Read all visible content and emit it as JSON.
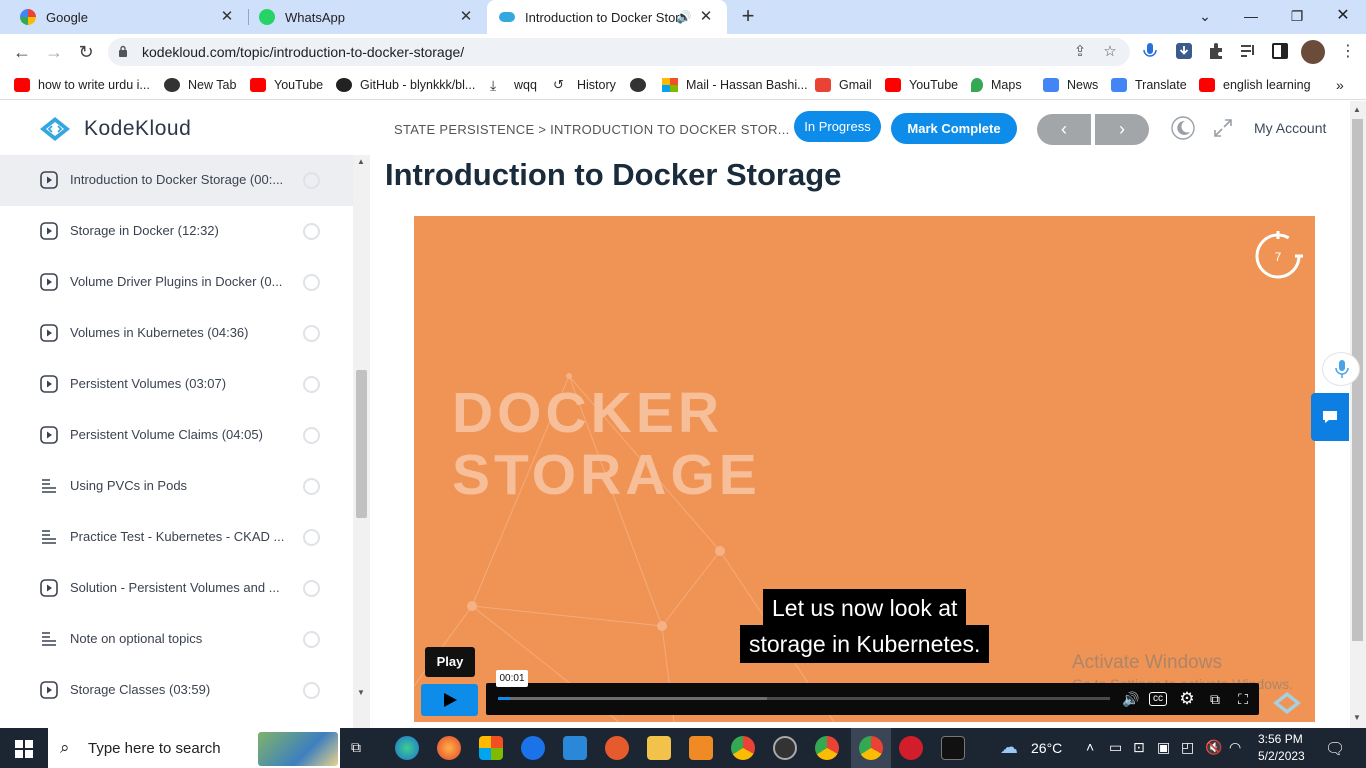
{
  "browser": {
    "tabs": [
      {
        "title": "Google",
        "favicon_color": "#4285f4"
      },
      {
        "title": "WhatsApp",
        "favicon_color": "#25d366"
      },
      {
        "title": "Introduction to Docker Stora",
        "favicon_color": "#35a7e0",
        "active": true
      }
    ],
    "url": "kodekloud.com/topic/introduction-to-docker-storage/"
  },
  "bookmarks": [
    {
      "label": "how to write urdu i...",
      "icon": "youtube-icon",
      "color": "#ff0000"
    },
    {
      "label": "New Tab",
      "icon": "globe-icon",
      "color": "#333333"
    },
    {
      "label": "YouTube",
      "icon": "youtube-icon",
      "color": "#ff0000"
    },
    {
      "label": "GitHub - blynkkk/bl...",
      "icon": "github-icon",
      "color": "#222222"
    },
    {
      "label": "wqq",
      "icon": "download-icon",
      "color": "#333333"
    },
    {
      "label": "History",
      "icon": "history-icon",
      "color": "#333333"
    },
    {
      "label": "",
      "icon": "globe-icon",
      "color": "#333333"
    },
    {
      "label": "Mail - Hassan Bashi...",
      "icon": "microsoft-icon",
      "color": "#f25022"
    },
    {
      "label": "Gmail",
      "icon": "gmail-icon",
      "color": "#ea4335"
    },
    {
      "label": "YouTube",
      "icon": "youtube-icon",
      "color": "#ff0000"
    },
    {
      "label": "Maps",
      "icon": "maps-icon",
      "color": "#34a853"
    },
    {
      "label": "News",
      "icon": "news-icon",
      "color": "#4285f4"
    },
    {
      "label": "Translate",
      "icon": "translate-icon",
      "color": "#4285f4"
    },
    {
      "label": "english learning",
      "icon": "youtube-icon",
      "color": "#ff0000"
    }
  ],
  "header": {
    "logo_text": "KodeKloud",
    "breadcrumb": "STATE PERSISTENCE > INTRODUCTION TO DOCKER STOR...",
    "status_label": "In Progress",
    "mark_complete_label": "Mark Complete",
    "prev_label": "‹",
    "next_label": "›",
    "account_label": "My Account",
    "accent": "#0d8ce9"
  },
  "sidebar": {
    "items": [
      {
        "label": "Introduction to Docker Storage (00:...",
        "type": "video",
        "current": true
      },
      {
        "label": "Storage in Docker (12:32)",
        "type": "video"
      },
      {
        "label": "Volume Driver Plugins in Docker (0...",
        "type": "video"
      },
      {
        "label": "Volumes in Kubernetes (04:36)",
        "type": "video"
      },
      {
        "label": "Persistent Volumes (03:07)",
        "type": "video"
      },
      {
        "label": "Persistent Volume Claims (04:05)",
        "type": "video"
      },
      {
        "label": "Using PVCs in Pods",
        "type": "text"
      },
      {
        "label": "Practice Test - Kubernetes - CKAD ...",
        "type": "text"
      },
      {
        "label": "Solution - Persistent Volumes and ...",
        "type": "video"
      },
      {
        "label": "Note on optional topics",
        "type": "text"
      },
      {
        "label": "Storage Classes (03:59)",
        "type": "video"
      }
    ]
  },
  "main": {
    "title": "Introduction to Docker Storage",
    "video": {
      "slide_line1": "DOCKER",
      "slide_line2": "STORAGE",
      "caption_line1": "Let us now look at",
      "caption_line2": "storage in Kubernetes.",
      "play_tooltip": "Play",
      "time_tooltip": "00:01",
      "badge_number": "7",
      "progress_fraction": 0.02,
      "buffered_fraction": 0.44,
      "bg_color": "#ef9454",
      "windows_line1": "Activate Windows",
      "windows_line2": "Go to Settings to activate Windows."
    }
  },
  "taskbar": {
    "search_placeholder": "Type here to search",
    "weather": "26°C",
    "time": "3:56 PM",
    "date": "5/2/2023"
  }
}
